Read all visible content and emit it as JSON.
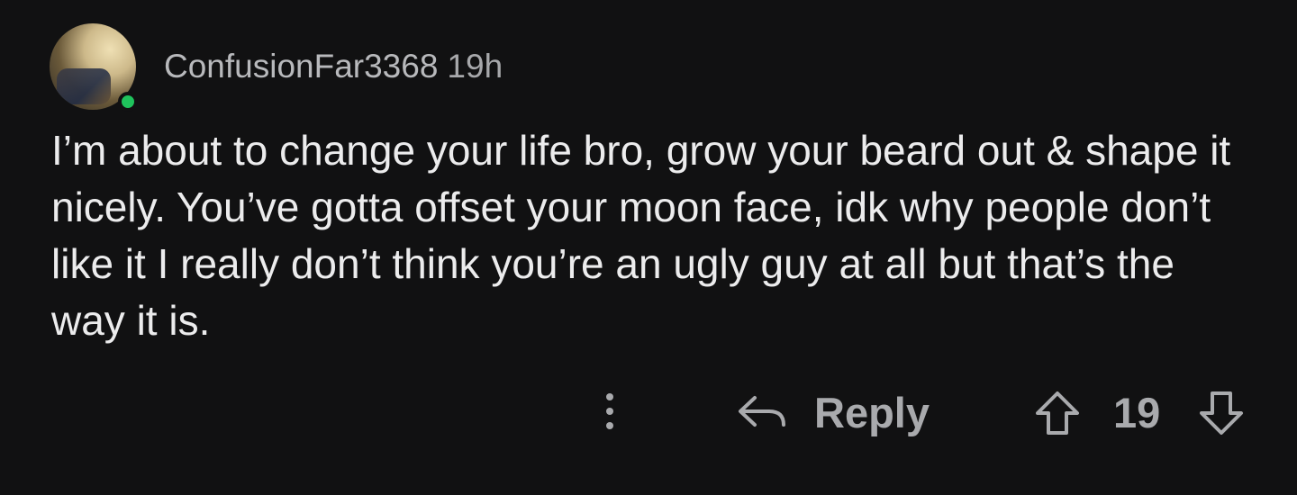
{
  "comment": {
    "username": "ConfusionFar3368",
    "age": "19h",
    "online": true,
    "body": "I’m about to change your life bro, grow your beard out & shape it nicely. You’ve gotta offset your moon face, idk why people don’t like it I really don’t think you’re an ugly guy at all but that’s the way it is.",
    "actions": {
      "more_icon": "more-vertical-icon",
      "reply_icon": "reply-arrow-icon",
      "reply_label": "Reply",
      "upvote_icon": "arrow-up-icon",
      "score": "19",
      "downvote_icon": "arrow-down-icon"
    }
  },
  "colors": {
    "background": "#111112",
    "text": "#ececed",
    "muted": "#a9aaad",
    "online": "#1fc35c"
  }
}
